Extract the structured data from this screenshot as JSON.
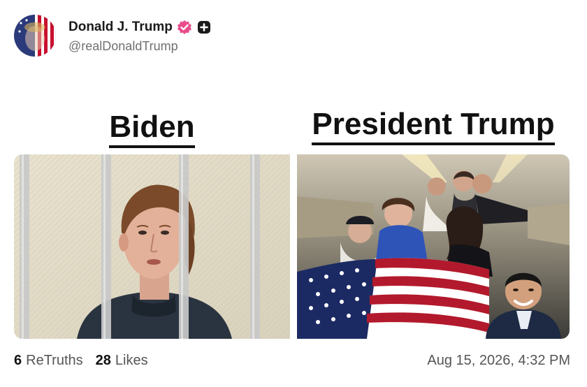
{
  "post": {
    "author": {
      "display_name": "Donald J. Trump",
      "handle": "@realDonaldTrump",
      "avatar_icon": "american-flag-portrait",
      "verified_icon": "verified-badge-icon",
      "verified_color": "#e94c8b",
      "extra_icon": "plus-badge-icon"
    },
    "meme": {
      "left_title": "Biden",
      "right_title": "President Trump",
      "left_image": "man-behind-bars-photo",
      "right_image": "group-with-american-flag-on-plane-photo"
    },
    "stats": {
      "retruths_count": "6",
      "retruths_label": "ReTruths",
      "likes_count": "28",
      "likes_label": "Likes"
    },
    "timestamp": "Aug 15, 2026, 4:32 PM"
  }
}
